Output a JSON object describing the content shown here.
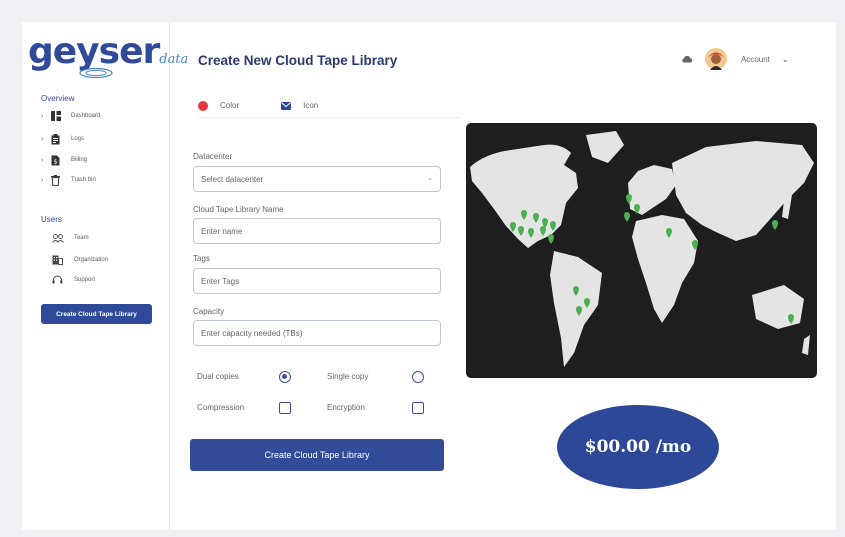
{
  "brand": {
    "name": "geyser",
    "suffix": "data"
  },
  "sidebar": {
    "overview_title": "Overview",
    "overview_items": [
      {
        "label": "Dashboard",
        "icon": "dashboard-icon"
      },
      {
        "label": "Logs",
        "icon": "clipboard-icon"
      },
      {
        "label": "Billing",
        "icon": "billing-icon"
      },
      {
        "label": "Trash bin",
        "icon": "trash-icon"
      }
    ],
    "users_title": "Users",
    "users_items": [
      {
        "label": "Team",
        "icon": "team-icon"
      },
      {
        "label": "Organization",
        "icon": "building-icon"
      },
      {
        "label": "Support",
        "icon": "headset-icon"
      }
    ],
    "cta_label": "Create Cloud Tape Library"
  },
  "header": {
    "title": "Create New Cloud Tape Library",
    "account_label": "Account"
  },
  "tabs": [
    {
      "label": "Color",
      "icon": "red-dot-icon"
    },
    {
      "label": "Icon",
      "icon": "envelope-icon"
    }
  ],
  "form": {
    "datacenter": {
      "label": "Datacenter",
      "placeholder": "Select datacenter"
    },
    "name": {
      "label": "Cloud Tape Library Name",
      "placeholder": "Enter name"
    },
    "tags": {
      "label": "Tags",
      "placeholder": "Enter Tags"
    },
    "capacity": {
      "label": "Capacity",
      "placeholder": "Enter capacity needed (TBs)"
    },
    "options": {
      "dual_copies": {
        "label": "Dual copies",
        "selected": true
      },
      "single_copy": {
        "label": "Single copy",
        "selected": false
      },
      "compression": {
        "label": "Compression",
        "checked": false
      },
      "encryption": {
        "label": "Encryption",
        "checked": false
      }
    },
    "submit_label": "Create Cloud Tape Library"
  },
  "price": {
    "text": "$00.00 /mo"
  },
  "colors": {
    "primary": "#2f4a98",
    "map_background": "#1e1e1e",
    "map_land": "#e4e4e4",
    "pin": "#4caf50",
    "accent_red": "#e23a3a"
  }
}
